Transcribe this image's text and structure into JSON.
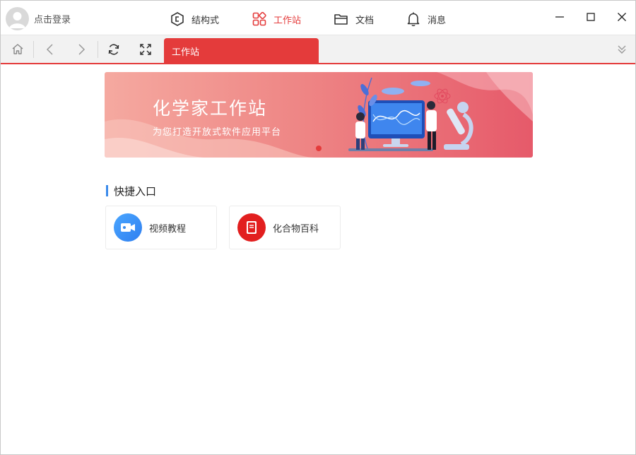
{
  "user": {
    "login_text": "点击登录"
  },
  "nav": {
    "tabs": [
      {
        "label": "结构式",
        "icon": "structure-icon"
      },
      {
        "label": "工作站",
        "icon": "workstation-icon",
        "active": true
      },
      {
        "label": "文档",
        "icon": "folder-icon"
      },
      {
        "label": "消息",
        "icon": "bell-icon"
      }
    ]
  },
  "toolbar": {
    "current_tab": "工作站"
  },
  "banner": {
    "title": "化学家工作站",
    "subtitle": "为您打造开放式软件应用平台"
  },
  "quick": {
    "title": "快捷入口",
    "items": [
      {
        "label": "视频教程",
        "icon": "video-camera-icon",
        "color": "#3b8beb"
      },
      {
        "label": "化合物百科",
        "icon": "book-icon",
        "color": "#e21f1f"
      }
    ]
  },
  "colors": {
    "accent": "#e43b3b",
    "section_bar": "#3b8beb"
  }
}
